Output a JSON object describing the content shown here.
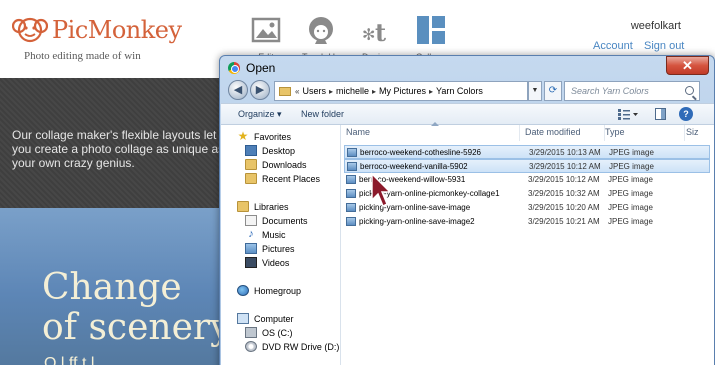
{
  "picmonkey": {
    "logo_text": "PicMonkey",
    "tagline": "Photo editing made of win",
    "nav": [
      {
        "label": "Edit",
        "icon": "image-icon"
      },
      {
        "label": "Touch Up",
        "icon": "face-icon"
      },
      {
        "label": "Design",
        "icon": "design-icon"
      },
      {
        "label": "Collage",
        "icon": "collage-icon"
      }
    ],
    "username": "weefolkart",
    "account_link": "Account",
    "signout_link": "Sign out",
    "promo_text": "Our collage maker's flexible layouts let you create a photo collage as unique as your own crazy genius.",
    "hero_line1": "Change",
    "hero_line2": "of scenery",
    "hero_partial": "O   l     ff    t        l"
  },
  "dialog": {
    "title": "Open",
    "close_label": "✕",
    "back_label": "◀",
    "forward_label": "▶",
    "breadcrumb": [
      "«",
      "Users",
      "michelle",
      "My Pictures",
      "Yarn Colors"
    ],
    "search_placeholder": "Search Yarn Colors",
    "organize_label": "Organize ▾",
    "new_folder_label": "New folder",
    "help_label": "?",
    "nav_items": [
      {
        "label": "Favorites",
        "icon": "star-icon"
      },
      {
        "label": "Desktop",
        "icon": "desktop-icon"
      },
      {
        "label": "Downloads",
        "icon": "downloads-icon"
      },
      {
        "label": "Recent Places",
        "icon": "recent-places-icon"
      },
      {
        "label": "Libraries",
        "icon": "libraries-icon"
      },
      {
        "label": "Documents",
        "icon": "documents-icon"
      },
      {
        "label": "Music",
        "icon": "music-icon"
      },
      {
        "label": "Pictures",
        "icon": "pictures-icon"
      },
      {
        "label": "Videos",
        "icon": "videos-icon"
      },
      {
        "label": "Homegroup",
        "icon": "homegroup-icon"
      },
      {
        "label": "Computer",
        "icon": "computer-icon"
      },
      {
        "label": "OS (C:)",
        "icon": "drive-icon"
      },
      {
        "label": "DVD RW Drive (D:) H",
        "icon": "dvd-icon"
      }
    ],
    "columns": [
      "Name",
      "Date modified",
      "Type",
      "Siz"
    ],
    "files": [
      {
        "name": "berroco-weekend-cothesline-5926",
        "date": "3/29/2015 10:13 AM",
        "type": "JPEG image",
        "selected": true
      },
      {
        "name": "berroco-weekend-vanilla-5902",
        "date": "3/29/2015 10:12 AM",
        "type": "JPEG image",
        "selected": true
      },
      {
        "name": "berroco-weekend-willow-5931",
        "date": "3/29/2015 10:12 AM",
        "type": "JPEG image",
        "selected": false
      },
      {
        "name": "picking-yarn-online-picmonkey-collage1",
        "date": "3/29/2015 10:32 AM",
        "type": "JPEG image",
        "selected": false
      },
      {
        "name": "picking-yarn-online-save-image",
        "date": "3/29/2015 10:20 AM",
        "type": "JPEG image",
        "selected": false
      },
      {
        "name": "picking-yarn-online-save-image2",
        "date": "3/29/2015 10:21 AM",
        "type": "JPEG image",
        "selected": false
      }
    ]
  },
  "colors": {
    "picmonkey_orange": "#d4623a",
    "link_blue": "#4a87c3",
    "selection": "#cde2f7",
    "cursor_red": "#8b1a2b"
  }
}
